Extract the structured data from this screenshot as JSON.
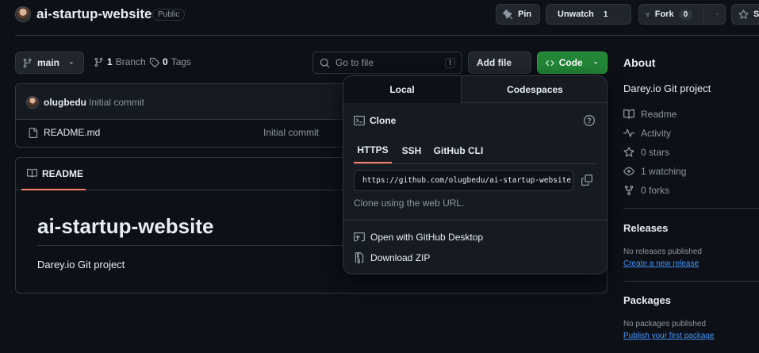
{
  "repo": {
    "name": "ai-startup-website",
    "visibility": "Public"
  },
  "header_actions": {
    "pin_label": "Pin",
    "unwatch_label": "Unwatch",
    "unwatch_count": "1",
    "fork_label": "Fork",
    "fork_count": "0",
    "star_label": "S"
  },
  "toolbar": {
    "branch": "main",
    "branches_count": "1",
    "branches_label": "Branch",
    "tags_count": "0",
    "tags_label": "Tags",
    "go_to_file_placeholder": "Go to file",
    "go_to_file_shortcut": "t",
    "add_file_label": "Add file",
    "code_label": "Code"
  },
  "commit": {
    "author": "olugbedu",
    "message": "Initial commit"
  },
  "files": [
    {
      "name": "README.md",
      "commit_message": "Initial commit"
    }
  ],
  "readme": {
    "tab_label": "README",
    "heading": "ai-startup-website",
    "body": "Darey.io Git project"
  },
  "code_popover": {
    "tabs": [
      "Local",
      "Codespaces"
    ],
    "clone_title": "Clone",
    "protocols": [
      "HTTPS",
      "SSH",
      "GitHub CLI"
    ],
    "clone_url": "https://github.com/olugbedu/ai-startup-website.",
    "clone_help": "Clone using the web URL.",
    "open_desktop": "Open with GitHub Desktop",
    "download_zip": "Download ZIP"
  },
  "about": {
    "title": "About",
    "description": "Darey.io Git project",
    "readme": "Readme",
    "activity": "Activity",
    "stars": "0 stars",
    "watching": "1 watching",
    "forks": "0 forks"
  },
  "releases": {
    "title": "Releases",
    "empty": "No releases published",
    "create_link": "Create a new release"
  },
  "packages": {
    "title": "Packages",
    "empty": "No packages published",
    "publish_link": "Publish your first package"
  },
  "colors": {
    "background": "#0d1117",
    "border": "#30363d",
    "code_button": "#238636",
    "link": "#4493f8",
    "tab_underline": "#f78166"
  },
  "icons": [
    "repo-avatar",
    "pin-icon",
    "eye-icon",
    "fork-icon",
    "star-icon",
    "branch-icon",
    "tag-icon",
    "search-icon",
    "code-icon",
    "file-icon",
    "book-icon",
    "terminal-icon",
    "help-icon",
    "copy-icon",
    "desktop-icon",
    "zip-icon",
    "pulse-icon"
  ]
}
